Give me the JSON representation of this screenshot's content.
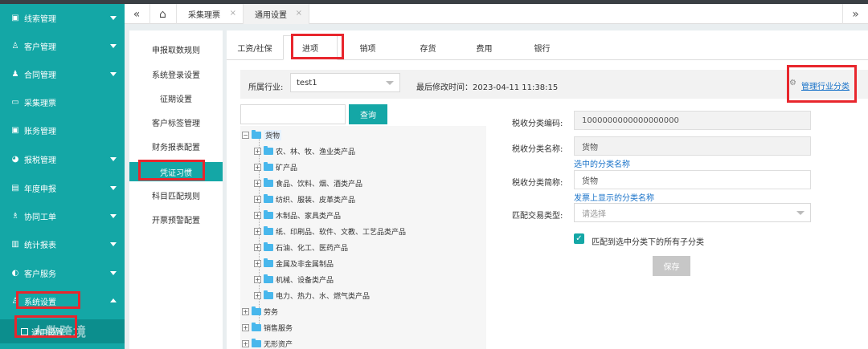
{
  "sidebar": {
    "items": [
      {
        "icon": "▣",
        "label": "线索管理"
      },
      {
        "icon": "♙",
        "label": "客户管理"
      },
      {
        "icon": "♟",
        "label": "合同管理"
      },
      {
        "icon": "▭",
        "label": "采集理票"
      },
      {
        "icon": "▣",
        "label": "账务管理"
      },
      {
        "icon": "◕",
        "label": "报税管理"
      },
      {
        "icon": "▤",
        "label": "年度申报"
      },
      {
        "icon": "♗",
        "label": "协同工单"
      },
      {
        "icon": "▥",
        "label": "统计报表"
      },
      {
        "icon": "◐",
        "label": "客户服务"
      },
      {
        "icon": "♙",
        "label": "系统设置"
      }
    ],
    "sub_item": "通用设置",
    "watermark": "人数跨境"
  },
  "tabstrip": {
    "collapse": "«",
    "home": "⌂",
    "expand": "»",
    "tabs": [
      {
        "label": "采集理票",
        "close": "×"
      },
      {
        "label": "通用设置",
        "close": "×"
      }
    ]
  },
  "config_menu": {
    "items": [
      "申报取数规则",
      "系统登录设置",
      "征期设置",
      "客户标签管理",
      "财务报表配置",
      "凭证习惯",
      "科目匹配规则",
      "开票预警配置"
    ]
  },
  "main": {
    "tabs": [
      "工资/社保",
      "进项",
      "销项",
      "存货",
      "费用",
      "银行"
    ],
    "industry_label": "所属行业:",
    "industry_value": "test1",
    "last_modified": "最后修改时间：2023-04-11 11:38:15",
    "manage_link": "管理行业分类",
    "search_button": "查询",
    "tree": {
      "root": "货物",
      "children": [
        "农、林、牧、渔业类产品",
        "矿产品",
        "食品、饮料、烟、酒类产品",
        "纺织、服装、皮革类产品",
        "木制品、家具类产品",
        "纸、印刷品、软件、文教、工艺品类产品",
        "石油、化工、医药产品",
        "金属及非金属制品",
        "机械、设备类产品",
        "电力、热力、水、燃气类产品"
      ],
      "others": [
        "劳务",
        "销售服务",
        "无形资产"
      ]
    },
    "form": {
      "code_label": "税收分类编码:",
      "code_value": "1000000000000000000",
      "name_label": "税收分类名称:",
      "name_value": "货物",
      "name_hint": "选中的分类名称",
      "short_label": "税收分类简称:",
      "short_value": "货物",
      "short_hint": "发票上显示的分类名称",
      "type_label": "匹配交易类型:",
      "type_placeholder": "请选择",
      "checkbox_label": "匹配到选中分类下的所有子分类",
      "save_button": "保存"
    }
  }
}
